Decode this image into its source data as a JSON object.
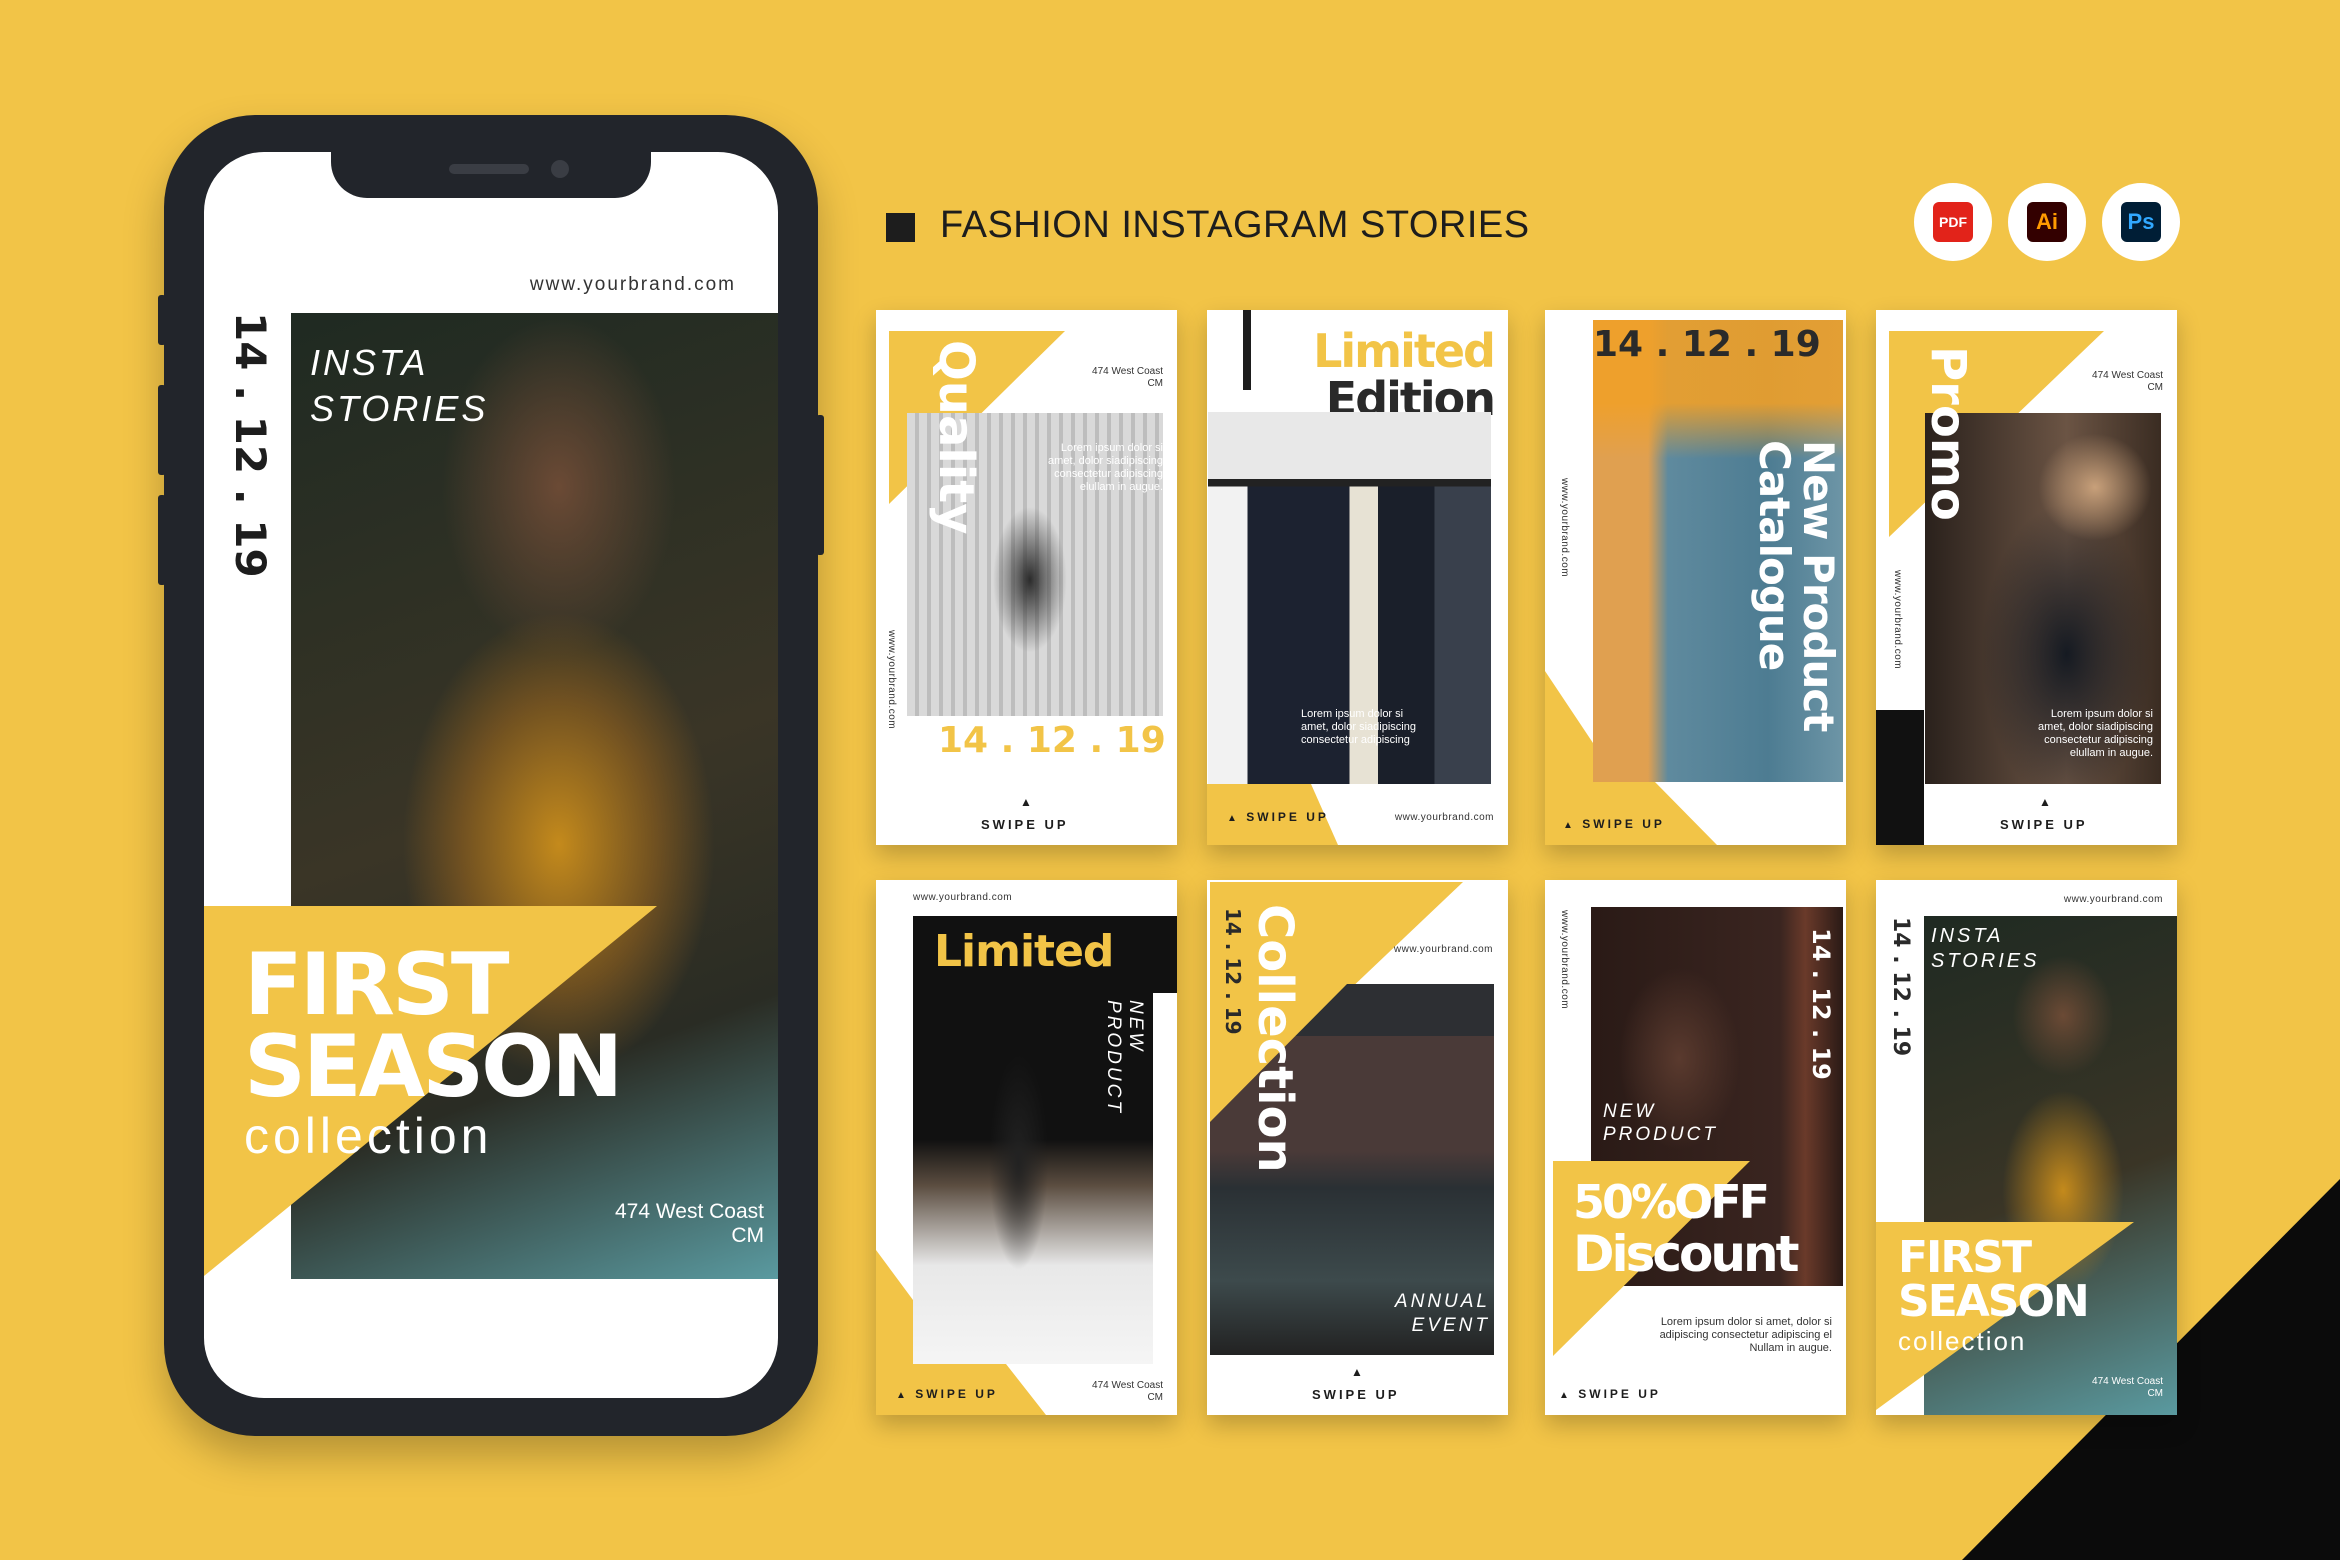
{
  "header": {
    "title": "FASHION INSTAGRAM STORIES",
    "file_icons": [
      {
        "name": "pdf-icon",
        "label": "PDF",
        "color": "#E2231A"
      },
      {
        "name": "illustrator-icon",
        "label": "Ai",
        "color": "#FF9A00"
      },
      {
        "name": "photoshop-icon",
        "label": "Ps",
        "color": "#31A8FF"
      }
    ]
  },
  "colors": {
    "background": "#F2C447",
    "accent": "#F2C447",
    "dark": "#1d1d1d"
  },
  "phone": {
    "website": "www.yourbrand.com",
    "date": "14 . 12 . 19",
    "insta": "INSTA",
    "stories": "STORIES",
    "first": "FIRST",
    "season": "SEASON",
    "collection": "collection",
    "address1": "474 West Coast",
    "address2": "CM"
  },
  "common": {
    "swipe": "SWIPE UP",
    "website": "www.yourbrand.com",
    "address1": "474 West Coast",
    "address2": "CM",
    "date": "14 . 12 . 19",
    "arrow": "▲"
  },
  "cards": [
    {
      "headline": "Quality",
      "lorem": [
        "Lorem ipsum dolor si",
        "amet, dolor siadipiscing",
        "consectetur adipiscing",
        "elullam in augue."
      ]
    },
    {
      "headline1": "Limited",
      "headline2": "Edition",
      "lorem": [
        "Lorem ipsum dolor si",
        "amet, dolor siadipiscing",
        "consectetur adipiscing"
      ]
    },
    {
      "headline1": "New Product",
      "headline2": "Catalogue"
    },
    {
      "headline": "Promo",
      "lorem": [
        "Lorem ipsum dolor si",
        "amet, dolor siadipiscing",
        "consectetur adipiscing",
        "elullam in augue."
      ]
    },
    {
      "headline": "Limited",
      "sub1": "NEW",
      "sub2": "PRODUCT"
    },
    {
      "headline": "Collection",
      "sub1": "ANNUAL",
      "sub2": "EVENT"
    },
    {
      "sub1": "NEW",
      "sub2": "PRODUCT",
      "headline1": "50%OFF",
      "headline2": "Discount",
      "lorem": [
        "Lorem ipsum dolor si amet, dolor si",
        "adipiscing consectetur adipiscing el",
        "Nullam in augue."
      ]
    },
    {
      "insta": "INSTA",
      "stories": "STORIES",
      "first": "FIRST",
      "season": "SEASON",
      "collection": "collection"
    }
  ]
}
